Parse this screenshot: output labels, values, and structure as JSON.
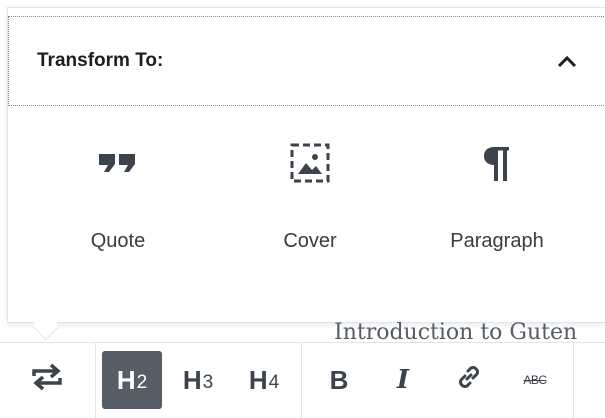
{
  "transform": {
    "title": "Transform To:",
    "items": [
      {
        "label": "Quote",
        "icon": "quote-icon"
      },
      {
        "label": "Cover",
        "icon": "cover-icon"
      },
      {
        "label": "Paragraph",
        "icon": "paragraph-icon"
      }
    ]
  },
  "content": {
    "text": "Introduction to Guten"
  },
  "toolbar": {
    "transform_icon": "transform-icon",
    "headings": [
      {
        "letter": "H",
        "level": "2",
        "active": true
      },
      {
        "letter": "H",
        "level": "3",
        "active": false
      },
      {
        "letter": "H",
        "level": "4",
        "active": false
      }
    ],
    "bold": "B",
    "italic": "I",
    "link_icon": "link-icon",
    "strike": "ABC"
  },
  "colors": {
    "active_bg": "#555d66",
    "text": "#1e1e1e",
    "border": "#e2e4e7"
  }
}
